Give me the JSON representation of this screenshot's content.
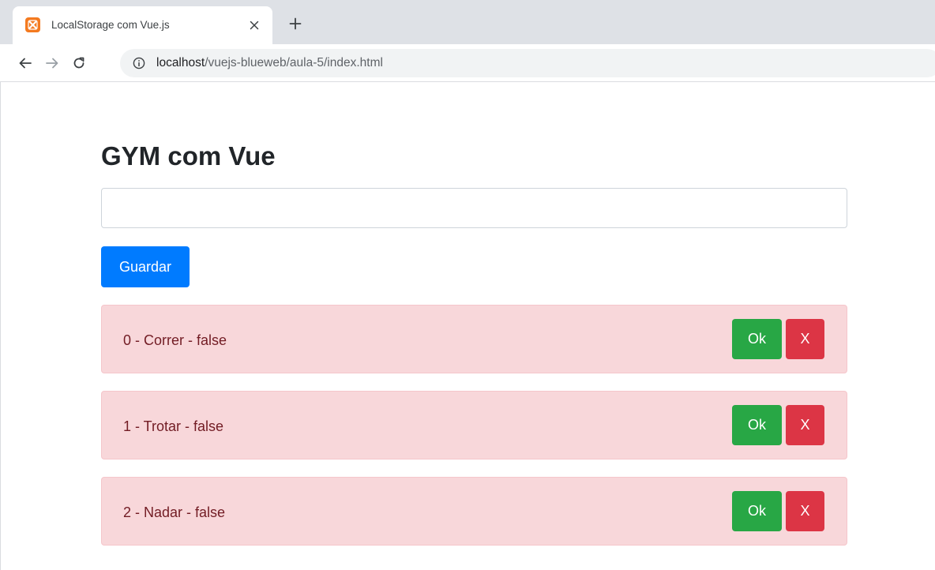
{
  "browser": {
    "tab_title": "LocalStorage com Vue.js",
    "favicon": "xampp-icon",
    "close_icon": "close-icon",
    "new_tab_icon": "plus-icon",
    "url_host": "localhost",
    "url_path": "/vuejs-blueweb/aula-5/index.html"
  },
  "page": {
    "title": "GYM com Vue",
    "input_value": "",
    "save_label": "Guardar",
    "tasks": [
      {
        "text": "0 - Correr - false",
        "ok_label": "Ok",
        "delete_label": "X"
      },
      {
        "text": "1 - Trotar - false",
        "ok_label": "Ok",
        "delete_label": "X"
      },
      {
        "text": "2 - Nadar - false",
        "ok_label": "Ok",
        "delete_label": "X"
      }
    ]
  },
  "colors": {
    "primary": "#007bff",
    "success": "#28a745",
    "danger": "#dc3545",
    "alert_bg": "#f8d7da",
    "alert_text": "#721c24"
  }
}
